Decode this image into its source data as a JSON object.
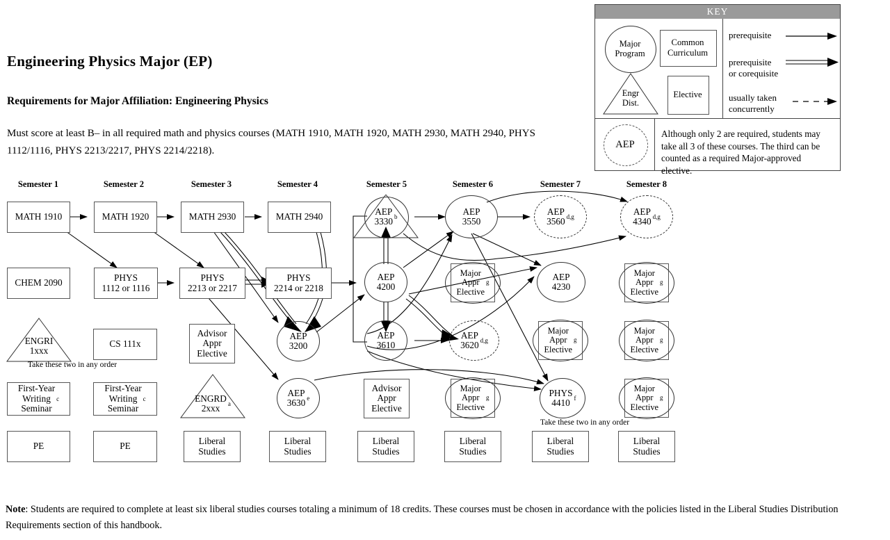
{
  "page": {
    "title": "Engineering Physics Major (EP)",
    "subtitle": "Requirements for Major Affiliation:  Engineering Physics",
    "requirements_text": "Must score at least B– in all required math and physics courses (MATH 1910, MATH 1920, MATH 2930, MATH 2940, PHYS 1112/1116, PHYS 2213/2217, PHYS 2214/2218).",
    "note_label": "Note",
    "note_text": ": Students are required to complete at least six liberal studies courses totaling a minimum of 18 credits.  These courses must be chosen in accordance with the policies listed in the Liberal Studies Distribution Requirements section of this handbook."
  },
  "key": {
    "header": "KEY",
    "shapes": {
      "major_program": "Major\nProgram",
      "common_curriculum": "Common\nCurriculum",
      "engr_dist": "Engr\nDist.",
      "elective": "Elective",
      "aep_dashed": "AEP"
    },
    "arrows": [
      {
        "label": "prerequisite",
        "style": "single"
      },
      {
        "label": "prerequisite\nor corequisite",
        "style": "double"
      },
      {
        "label": "usually taken\nconcurrently",
        "style": "dashed"
      }
    ],
    "footnote": "Although only 2 are required, students may take all 3 of these courses. The third can be counted as a required Major-approved elective."
  },
  "semester_headers": [
    "Semester 1",
    "Semester 2",
    "Semester 3",
    "Semester 4",
    "Semester 5",
    "Semester 6",
    "Semester 7",
    "Semester 8"
  ],
  "captions": {
    "take_two_left": "Take these two in any order",
    "take_two_right": "Take these two in any order"
  },
  "colors": {
    "key_header_bg": "#9a9a9a",
    "box_border": "#555555",
    "line": "#000000",
    "background": "#ffffff"
  },
  "nodes": [
    {
      "id": "math1910",
      "label": "MATH 1910",
      "shape": "box",
      "sup": ""
    },
    {
      "id": "math1920",
      "label": "MATH 1920",
      "shape": "box",
      "sup": ""
    },
    {
      "id": "math2930",
      "label": "MATH 2930",
      "shape": "box",
      "sup": ""
    },
    {
      "id": "math2940",
      "label": "MATH 2940",
      "shape": "box",
      "sup": ""
    },
    {
      "id": "chem2090",
      "label": "CHEM 2090",
      "shape": "box",
      "sup": ""
    },
    {
      "id": "phys1112",
      "label": "PHYS\n1112 or 1116",
      "shape": "box",
      "sup": ""
    },
    {
      "id": "phys2213",
      "label": "PHYS\n2213 or 2217",
      "shape": "box",
      "sup": ""
    },
    {
      "id": "phys2214",
      "label": "PHYS\n2214 or 2218",
      "shape": "box",
      "sup": ""
    },
    {
      "id": "engri1xxx",
      "label": "ENGRI\n1xxx",
      "shape": "triangle",
      "sup": ""
    },
    {
      "id": "cs111x",
      "label": "CS 111x",
      "shape": "box",
      "sup": ""
    },
    {
      "id": "advisor3",
      "label": "Advisor\nAppr\nElective",
      "shape": "box",
      "sup": ""
    },
    {
      "id": "engrd2xxx",
      "label": "ENGRD\n2xxx",
      "shape": "triangle",
      "sup": "a"
    },
    {
      "id": "fws1",
      "label": "First-Year\nWriting\nSeminar",
      "shape": "box",
      "sup": "c"
    },
    {
      "id": "fws2",
      "label": "First-Year\nWriting\nSeminar",
      "shape": "box",
      "sup": "c"
    },
    {
      "id": "pe1",
      "label": "PE",
      "shape": "box",
      "sup": ""
    },
    {
      "id": "pe2",
      "label": "PE",
      "shape": "box",
      "sup": ""
    },
    {
      "id": "ls3",
      "label": "Liberal\nStudies",
      "shape": "box",
      "sup": ""
    },
    {
      "id": "ls4",
      "label": "Liberal\nStudies",
      "shape": "box",
      "sup": ""
    },
    {
      "id": "ls5",
      "label": "Liberal\nStudies",
      "shape": "box",
      "sup": ""
    },
    {
      "id": "ls6",
      "label": "Liberal\nStudies",
      "shape": "box",
      "sup": ""
    },
    {
      "id": "ls7",
      "label": "Liberal\nStudies",
      "shape": "box",
      "sup": ""
    },
    {
      "id": "ls8",
      "label": "Liberal\nStudies",
      "shape": "box",
      "sup": ""
    },
    {
      "id": "aep3200",
      "label": "AEP\n3200",
      "shape": "circle",
      "sup": ""
    },
    {
      "id": "aep3630",
      "label": "AEP\n3630",
      "shape": "circle",
      "sup": "e"
    },
    {
      "id": "aep3330",
      "label": "AEP\n3330",
      "shape": "circle-in-triangle",
      "sup": "b"
    },
    {
      "id": "aep4200",
      "label": "AEP\n4200",
      "shape": "circle",
      "sup": ""
    },
    {
      "id": "aep3610",
      "label": "AEP\n3610",
      "shape": "circle",
      "sup": ""
    },
    {
      "id": "advisor5",
      "label": "Advisor\nAppr\nElective",
      "shape": "box",
      "sup": ""
    },
    {
      "id": "aep3550",
      "label": "AEP\n3550",
      "shape": "circle",
      "sup": ""
    },
    {
      "id": "mae6a",
      "label": "Major\nAppr\nElective",
      "shape": "box-circle",
      "sup": "g"
    },
    {
      "id": "aep3620",
      "label": "AEP\n3620",
      "shape": "dashed-circle",
      "sup": "d,g"
    },
    {
      "id": "mae6b",
      "label": "Major\nAppr\nElective",
      "shape": "box-circle",
      "sup": "g"
    },
    {
      "id": "aep3560",
      "label": "AEP\n3560",
      "shape": "dashed-circle",
      "sup": "d,g"
    },
    {
      "id": "aep4230",
      "label": "AEP\n4230",
      "shape": "circle",
      "sup": ""
    },
    {
      "id": "mae7",
      "label": "Major\nAppr\nElective",
      "shape": "box-circle",
      "sup": "g"
    },
    {
      "id": "phys4410",
      "label": "PHYS\n4410",
      "shape": "circle",
      "sup": "f"
    },
    {
      "id": "aep4340",
      "label": "AEP\n4340",
      "shape": "dashed-circle",
      "sup": "d,g"
    },
    {
      "id": "mae8a",
      "label": "Major\nAppr\nElective",
      "shape": "box-circle",
      "sup": "g"
    },
    {
      "id": "mae8b",
      "label": "Major\nAppr\nElective",
      "shape": "box-circle",
      "sup": "g"
    },
    {
      "id": "mae8c",
      "label": "Major\nAppr\nElective",
      "shape": "box-circle",
      "sup": "g"
    }
  ]
}
